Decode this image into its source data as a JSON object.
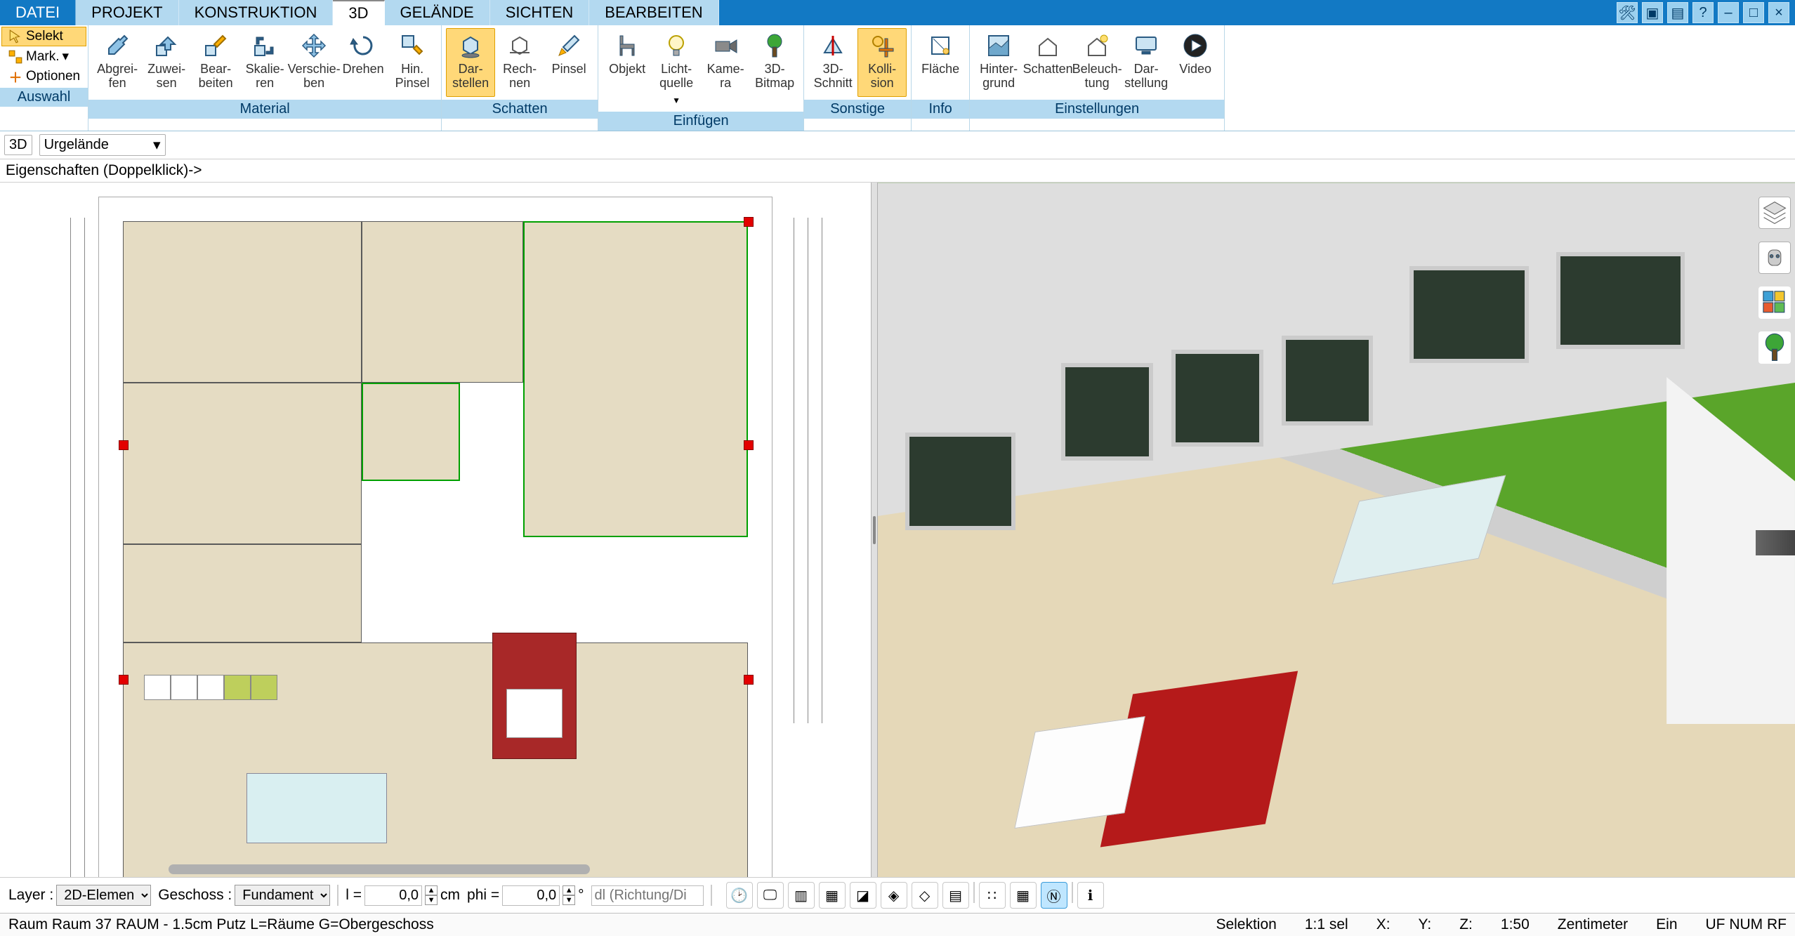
{
  "menu": {
    "datei": "DATEI",
    "projekt": "PROJEKT",
    "konstruktion": "KONSTRUKTION",
    "d3": "3D",
    "gelande": "GELÄNDE",
    "sichten": "SICHTEN",
    "bearbeiten": "BEARBEITEN"
  },
  "auswahl": {
    "selekt": "Selekt",
    "mark": "Mark.",
    "optionen": "Optionen",
    "group": "Auswahl"
  },
  "ribbon": {
    "material": {
      "title": "Material",
      "abgreifen": "Abgrei-\nfen",
      "zuweisen": "Zuwei-\nsen",
      "bearbeiten": "Bear-\nbeiten",
      "skalieren": "Skalie-\nren",
      "verschieben": "Verschie-\nben",
      "drehen": "Drehen",
      "hinpinsel": "Hin.\nPinsel"
    },
    "schatten": {
      "title": "Schatten",
      "darstellen": "Dar-\nstellen",
      "rechnen": "Rech-\nnen",
      "pinsel": "Pinsel"
    },
    "einfuegen": {
      "title": "Einfügen",
      "objekt": "Objekt",
      "lichtquelle": "Licht-\nquelle",
      "kamera": "Kame-\nra",
      "bitmap": "3D-\nBitmap"
    },
    "sonstige": {
      "title": "Sonstige",
      "schnitt": "3D-\nSchnitt",
      "kollision": "Kolli-\nsion"
    },
    "info": {
      "title": "Info",
      "flaeche": "Fläche"
    },
    "einstellungen": {
      "title": "Einstellungen",
      "hintergrund": "Hinter-\ngrund",
      "schatten": "Schatten",
      "beleuchtung": "Beleuch-\ntung",
      "darstellung": "Dar-\nstellung",
      "video": "Video"
    }
  },
  "secondary": {
    "view_mode": "3D",
    "layer_select": "Urgelände"
  },
  "props_hint": "Eigenschaften (Doppelklick)->",
  "bottom": {
    "layer_lbl": "Layer :",
    "layer_val": "2D-Elemen",
    "geschoss_lbl": "Geschoss :",
    "geschoss_val": "Fundament",
    "l_lbl": "l =",
    "l_val": "0,0",
    "cm": "cm",
    "phi_lbl": "phi =",
    "phi_val": "0,0",
    "deg": "°",
    "dl_placeholder": "dl (Richtung/Di"
  },
  "status": {
    "left": "Raum Raum 37 RAUM - 1.5cm Putz L=Räume G=Obergeschoss",
    "selektion": "Selektion",
    "sel": "1:1 sel",
    "x": "X:",
    "y": "Y:",
    "z": "Z:",
    "scale": "1:50",
    "unit": "Zentimeter",
    "ein": "Ein",
    "ufnum": "UF NUM RF"
  }
}
